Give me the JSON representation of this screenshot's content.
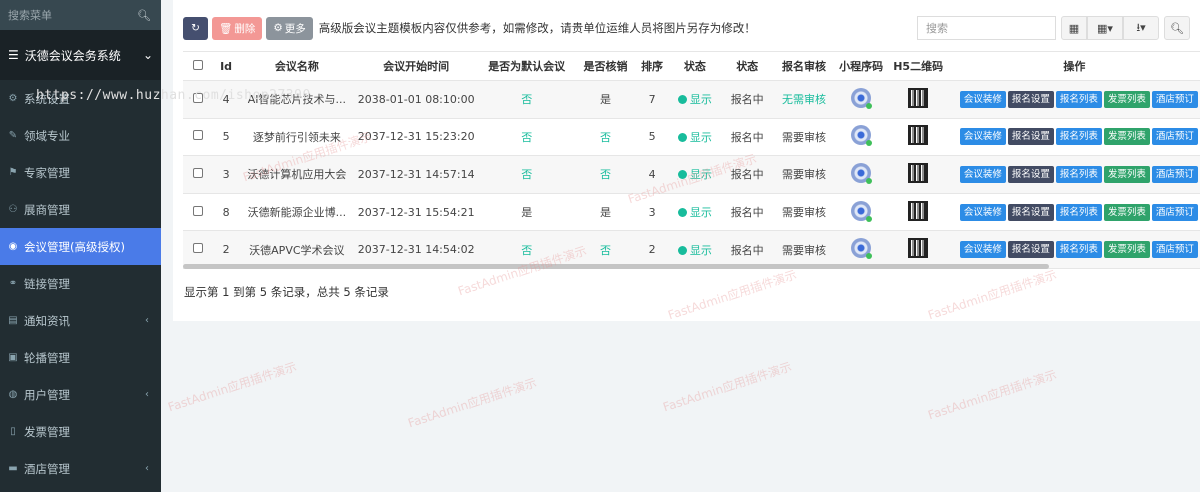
{
  "sidebar": {
    "search_placeholder": "搜索菜单",
    "group_label": "沃德会议会务系统",
    "items": [
      {
        "label": "系统设置",
        "icon": "gear-icon",
        "chevron": false,
        "active": false
      },
      {
        "label": "领域专业",
        "icon": "pencil-icon",
        "chevron": false,
        "active": false
      },
      {
        "label": "专家管理",
        "icon": "graduation-cap-icon",
        "chevron": false,
        "active": false
      },
      {
        "label": "展商管理",
        "icon": "users-icon",
        "chevron": false,
        "active": false
      },
      {
        "label": "会议管理(高级授权)",
        "icon": "circle-icon",
        "chevron": false,
        "active": true
      },
      {
        "label": "链接管理",
        "icon": "link-icon",
        "chevron": false,
        "active": false
      },
      {
        "label": "通知资讯",
        "icon": "newspaper-icon",
        "chevron": true,
        "active": false
      },
      {
        "label": "轮播管理",
        "icon": "image-icon",
        "chevron": false,
        "active": false
      },
      {
        "label": "用户管理",
        "icon": "user-circle-icon",
        "chevron": true,
        "active": false
      },
      {
        "label": "发票管理",
        "icon": "file-icon",
        "chevron": false,
        "active": false
      },
      {
        "label": "酒店管理",
        "icon": "bed-icon",
        "chevron": true,
        "active": false
      }
    ]
  },
  "toolbar": {
    "refresh_icon": "refresh-icon",
    "delete_label": "删除",
    "more_label": "更多",
    "notice": "高级版会议主题模板内容仅供参考，如需修改，请贵单位运维人员将图片另存为修改！",
    "search_placeholder": "搜索"
  },
  "table": {
    "headers": [
      "Id",
      "会议名称",
      "会议开始时间",
      "是否为默认会议",
      "是否核销",
      "排序",
      "状态",
      "状态",
      "报名审核",
      "小程序码",
      "H5二维码",
      "操作"
    ],
    "rows": [
      {
        "id": "4",
        "name": "AI智能芯片技术与...",
        "start": "2038-01-01 08:10:00",
        "default": "否",
        "verify": "是",
        "sort": "7",
        "status": "显示",
        "state": "报名中",
        "audit": "无需审核"
      },
      {
        "id": "5",
        "name": "逐梦前行引领未来",
        "start": "2037-12-31 15:23:20",
        "default": "否",
        "verify": "否",
        "sort": "5",
        "status": "显示",
        "state": "报名中",
        "audit": "需要审核"
      },
      {
        "id": "3",
        "name": "沃德计算机应用大会",
        "start": "2037-12-31 14:57:14",
        "default": "否",
        "verify": "否",
        "sort": "4",
        "status": "显示",
        "state": "报名中",
        "audit": "需要审核"
      },
      {
        "id": "8",
        "name": "沃德新能源企业博...",
        "start": "2037-12-31 15:54:21",
        "default": "是",
        "verify": "是",
        "sort": "3",
        "status": "显示",
        "state": "报名中",
        "audit": "需要审核"
      },
      {
        "id": "2",
        "name": "沃德APVC学术会议",
        "start": "2037-12-31 14:54:02",
        "default": "否",
        "verify": "否",
        "sort": "2",
        "status": "显示",
        "state": "报名中",
        "audit": "需要审核"
      }
    ],
    "ops": [
      "会议装修",
      "报名设置",
      "报名列表",
      "发票列表",
      "酒店预订"
    ]
  },
  "footer": {
    "info": "显示第 1 到第 5 条记录，总共 5 条记录"
  },
  "overlay": {
    "url": "https://www.huzhan.com/ishop27390"
  },
  "watermark": "FastAdmin应用插件演示"
}
